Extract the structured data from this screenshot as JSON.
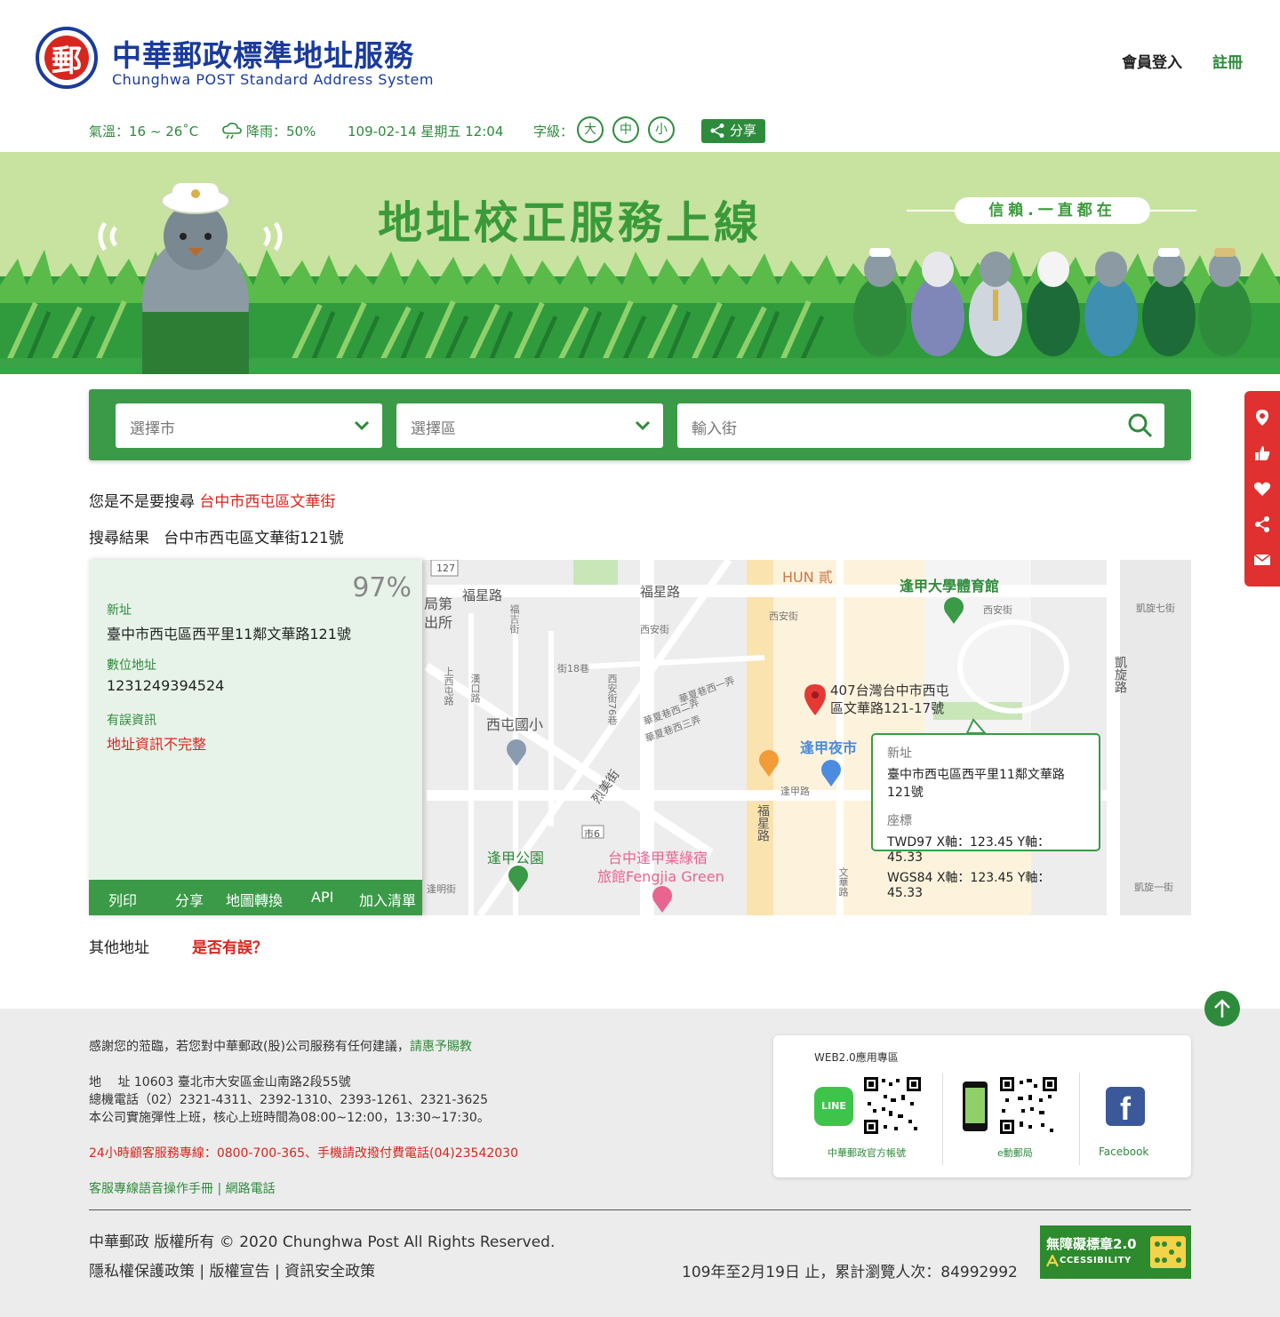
{
  "header": {
    "logo_char": "郵",
    "title": "中華郵政標準地址服務",
    "subtitle": "Chunghwa POST Standard Address System",
    "login": "會員登入",
    "register": "註冊"
  },
  "infobar": {
    "temperature": "氣溫：16 ~ 26˚C",
    "rain": "降雨：50%",
    "datetime": "109-02-14 星期五 12:04",
    "font_label": "字級：",
    "font_large": "大",
    "font_medium": "中",
    "font_small": "小",
    "share": "分享"
  },
  "banner": {
    "title": "地址校正服務上線",
    "slogan": "信賴.一直都在"
  },
  "search": {
    "city_placeholder": "選擇市",
    "district_placeholder": "選擇區",
    "street_placeholder": "輸入街"
  },
  "suggest": {
    "prefix": "您是不是要搜尋",
    "link": "台中市西屯區文華街"
  },
  "result": {
    "label": "搜尋結果",
    "address": "台中市西屯區文華街121號"
  },
  "info": {
    "percent": "97%",
    "new_addr_label": "新址",
    "new_addr": "臺中市西屯區西平里11鄰文華路121號",
    "digital_label": "數位地址",
    "digital": "1231249394524",
    "error_label": "有誤資訊",
    "error": "地址資訊不完整",
    "actions": [
      "列印",
      "分享",
      "地圖轉換",
      "API",
      "加入清單"
    ]
  },
  "map": {
    "labels": {
      "hun": "HUN 貳",
      "university_gym": "逢甲大學體育館",
      "fuxing_rd": "福星路",
      "fuxing_rd2": "福星路",
      "xian_st": "西安街",
      "xian_st2": "西安街",
      "xian_st3": "西安街",
      "kaixuan7": "凱旋七街",
      "kaixuan_rd": "凱旋路",
      "kaixuan1": "凱旋一街",
      "ju_office": "局第",
      "ju_office2": "出所",
      "pin_addr1": "407台灣台中市西屯",
      "pin_addr2": "區文華路121-17號",
      "xitun_school": "西屯國小",
      "fengjia_night": "逢甲夜市",
      "fengjia_rd": "逢甲路",
      "fengjia_park": "逢甲公園",
      "hotel1": "台中逢甲葉綠宿",
      "hotel2": "旅館Fengjia Green",
      "lieme_st": "烈美街",
      "fuxing_rd3": "福星路",
      "wenhua_rd": "文華路",
      "route127": "127",
      "route6": "市6",
      "xiangxi1": "華夏巷西一弄",
      "xiangxi2": "華夏巷西二弄",
      "xiangxi3": "華夏巷西三弄",
      "lane18": "街18巷",
      "xian76": "西安街76巷",
      "fengming": "逢明街",
      "wulang": "上西屯路",
      "hanxi": "漢口路",
      "fuan": "福吉街"
    },
    "popup": {
      "new_label": "新址",
      "new_addr": "臺中市西屯區西平里11鄰文華路121號",
      "coord_label": "座標",
      "twd97": "TWD97 X軸：123.45 Y軸：45.33",
      "wgs84": "WGS84 X軸：123.45 Y軸：45.33"
    }
  },
  "others": {
    "label": "其他地址",
    "report": "是否有誤？"
  },
  "footer": {
    "thanks": "感謝您的蒞臨，若您對中華郵政(股)公司服務有任何建議，",
    "thanks_link": "請惠予賜教",
    "address": "地　 址  10603 臺北市大安區金山南路2段55號",
    "phone": "總機電話（02）2321-4311、2392-1310、2393-1261、2321-3625",
    "hours": "本公司實施彈性上班，核心上班時間為08:00~12:00，13:30~17:30。",
    "hotline": "24小時顧客服務專線：0800-700-365、手機請改撥付費電話(04)23542030",
    "manual": "客服專線語音操作手冊 | 網路電話",
    "copyright": "中華郵政 版權所有 © 2020 Chunghwa Post All Rights Reserved.",
    "policy": "隱私權保護政策 | 版權宣告 | 資訊安全政策",
    "visits": "109年至2月19日 止，累計瀏覽人次：84992992",
    "web_title": "WEB2.0應用專區",
    "line_caption": "中華郵政官方帳號",
    "line_icon": "LINE",
    "emobile_caption": "e動郵局",
    "facebook_caption": "Facebook",
    "badge_line1": "無障礙標章2.0",
    "badge_line2": "CCESSIBILITY"
  },
  "colors": {
    "brand_blue": "#1a3b9c",
    "brand_green": "#2e8b3c",
    "accent_red": "#d7261e",
    "search_green": "#3a9a47"
  }
}
